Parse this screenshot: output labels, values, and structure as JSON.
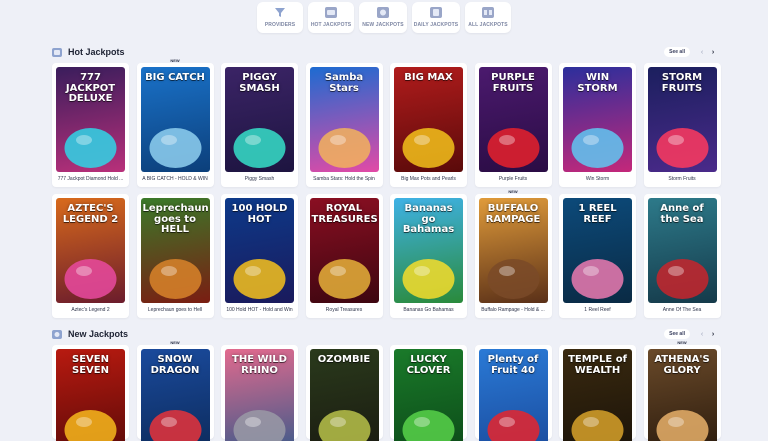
{
  "tabs": [
    {
      "label": "PROVIDERS",
      "icon": "funnel-icon"
    },
    {
      "label": "HOT JACKPOTS",
      "icon": "hot-jackpots-icon"
    },
    {
      "label": "NEW JACKPOTS",
      "icon": "new-jackpots-icon"
    },
    {
      "label": "DAILY JACKPOTS",
      "icon": "daily-jackpots-icon"
    },
    {
      "label": "ALL JACKPOTS",
      "icon": "all-jackpots-icon"
    }
  ],
  "hot": {
    "title": "Hot Jackpots",
    "see_all": "See all",
    "row1": [
      {
        "name": "777 Jackpot Diamond Hold ...",
        "logo": "777 JACKPOT DELUXE",
        "new": "",
        "bg1": "#3a1d5c",
        "bg2": "#b8307a",
        "art": "#2fd6e8"
      },
      {
        "name": "A BIG CATCH - HOLD & WIN",
        "logo": "BIG CATCH",
        "new": "NEW",
        "bg1": "#1a72c9",
        "bg2": "#0c3f7a",
        "art": "#8fd0f0"
      },
      {
        "name": "Piggy Smash",
        "logo": "PIGGY SMASH",
        "new": "",
        "bg1": "#3b2466",
        "bg2": "#1d1440",
        "art": "#36e0c9"
      },
      {
        "name": "Samba Stars: Hold the Spin",
        "logo": "Samba Stars",
        "new": "",
        "bg1": "#1d6bd1",
        "bg2": "#e24aa6",
        "art": "#f2b35c"
      },
      {
        "name": "Big Max Pots and Pearls",
        "logo": "BIG MAX",
        "new": "",
        "bg1": "#b11c1c",
        "bg2": "#5a0a0a",
        "art": "#f3c21b"
      },
      {
        "name": "Purple Fruits",
        "logo": "PURPLE FRUITS",
        "new": "",
        "bg1": "#4b1a6e",
        "bg2": "#2a0c44",
        "art": "#e8212c"
      },
      {
        "name": "Win Storm",
        "logo": "WIN STORM",
        "new": "",
        "bg1": "#2c2f9c",
        "bg2": "#c4287a",
        "art": "#5fc8f2"
      },
      {
        "name": "Storm Fruits",
        "logo": "STORM FRUITS",
        "new": "",
        "bg1": "#1b1f5e",
        "bg2": "#4a2a8a",
        "art": "#ff3a5e"
      }
    ],
    "row2": [
      {
        "name": "Aztec's Legend 2",
        "logo": "AZTEC'S LEGEND 2",
        "new": "",
        "bg1": "#d86a1c",
        "bg2": "#6b1c2c",
        "art": "#e94aa0"
      },
      {
        "name": "Leprechaun goes to Hell",
        "logo": "Leprechaun goes to HELL",
        "new": "",
        "bg1": "#3a7a2a",
        "bg2": "#7a1d12",
        "art": "#d9842a"
      },
      {
        "name": "100 Hold HOT - Hold and Win",
        "logo": "100 HOLD HOT",
        "new": "",
        "bg1": "#0d3a8a",
        "bg2": "#1a1a5c",
        "art": "#f7c21c"
      },
      {
        "name": "Royal Treasures",
        "logo": "ROYAL TREASURES",
        "new": "",
        "bg1": "#8a0f22",
        "bg2": "#3d0610",
        "art": "#e6b13a"
      },
      {
        "name": "Bananas Go Bahamas",
        "logo": "Bananas go Bahamas",
        "new": "",
        "bg1": "#3fb2e6",
        "bg2": "#2a8a3a",
        "art": "#f7dd2c"
      },
      {
        "name": "Buffalo Rampage - Hold & ...",
        "logo": "BUFFALO RAMPAGE",
        "new": "NEW",
        "bg1": "#e09b3a",
        "bg2": "#5a3018",
        "art": "#7a4a28"
      },
      {
        "name": "1 Reel Reef",
        "logo": "1 REEL REEF",
        "new": "",
        "bg1": "#0c4a7a",
        "bg2": "#0a2a44",
        "art": "#ec7ab0"
      },
      {
        "name": "Anne Of The Sea",
        "logo": "Anne of the Sea",
        "new": "",
        "bg1": "#2d7a8a",
        "bg2": "#153a4a",
        "art": "#c8242c"
      }
    ]
  },
  "new": {
    "title": "New Jackpots",
    "see_all": "See all",
    "row": [
      {
        "name": "",
        "logo": "SEVEN SEVEN",
        "new": "",
        "bg1": "#b81a10",
        "bg2": "#5a0a08",
        "art": "#f7b81c"
      },
      {
        "name": "",
        "logo": "SNOW DRAGON",
        "new": "NEW",
        "bg1": "#1a4a9c",
        "bg2": "#0c2a5a",
        "art": "#e8323a"
      },
      {
        "name": "",
        "logo": "THE WILD RHINO",
        "new": "",
        "bg1": "#e26a8e",
        "bg2": "#3a5a8a",
        "art": "#9a9aa6"
      },
      {
        "name": "",
        "logo": "OZOMBIE",
        "new": "",
        "bg1": "#2a3a1c",
        "bg2": "#1a1a10",
        "art": "#b8c24a"
      },
      {
        "name": "",
        "logo": "LUCKY CLOVER",
        "new": "",
        "bg1": "#1a7a2a",
        "bg2": "#0c4a18",
        "art": "#58d24a"
      },
      {
        "name": "",
        "logo": "Plenty of Fruit 40",
        "new": "",
        "bg1": "#2a7ad6",
        "bg2": "#1a4a9c",
        "art": "#e8252c"
      },
      {
        "name": "",
        "logo": "TEMPLE of WEALTH",
        "new": "",
        "bg1": "#3a2a10",
        "bg2": "#1a1208",
        "art": "#d8a22a"
      },
      {
        "name": "",
        "logo": "ATHENA'S GLORY",
        "new": "NEW",
        "bg1": "#6a4a2a",
        "bg2": "#2a1a0c",
        "art": "#e8b06a"
      }
    ]
  }
}
